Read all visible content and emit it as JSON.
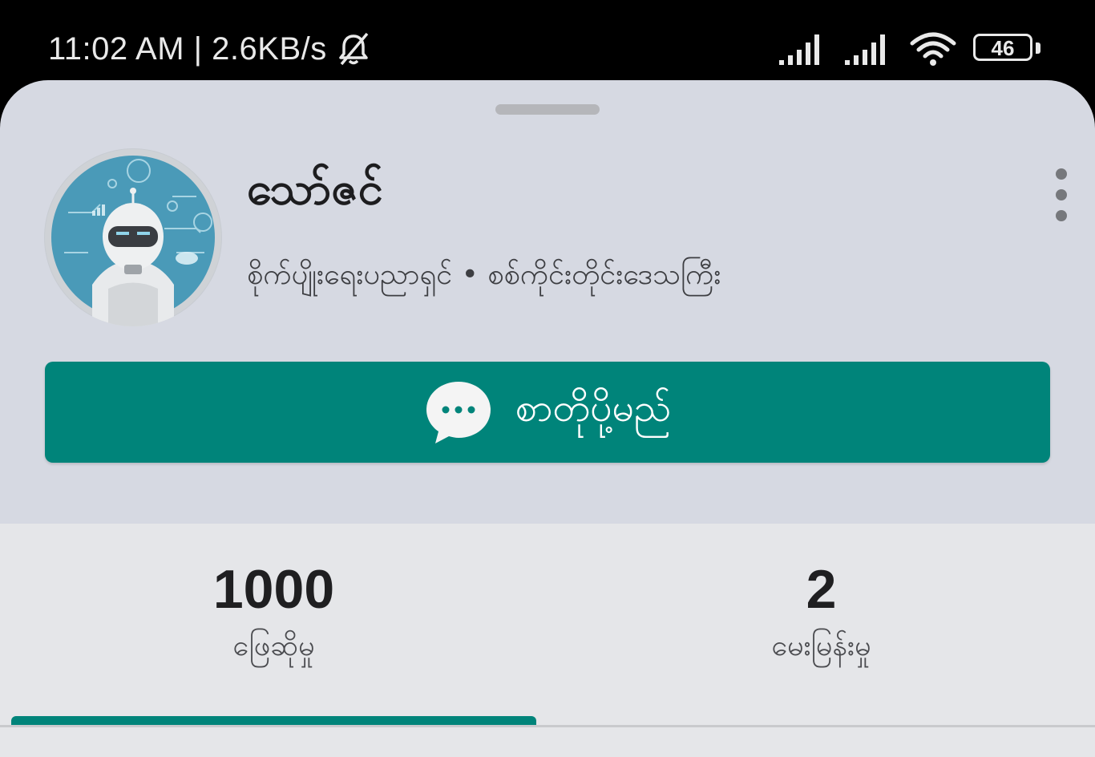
{
  "status_bar": {
    "time_speed": "11:02 AM | 2.6KB/s",
    "battery": "46"
  },
  "profile": {
    "name": "သော်ဇင်",
    "subtitle": "စိုက်ပျိုးရေးပညာရှင် • စစ်ကိုင်းတိုင်းဒေသကြီး"
  },
  "actions": {
    "message_label": "စာတိုပို့မည်"
  },
  "stats": [
    {
      "value": "1000",
      "label": "ဖြေဆိုမှု"
    },
    {
      "value": "2",
      "label": "မေးမြန်းမှု"
    }
  ],
  "colors": {
    "accent": "#00847a",
    "sheet_background": "#d6d9e2",
    "stats_background": "#e5e6e9"
  }
}
